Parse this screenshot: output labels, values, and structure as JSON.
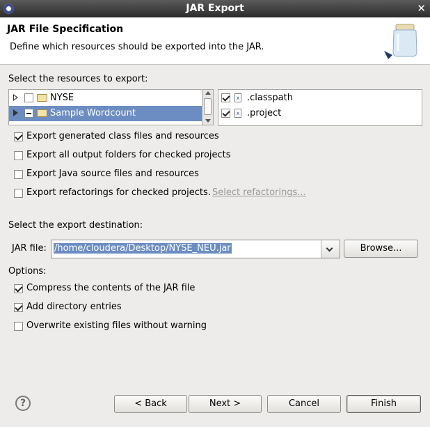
{
  "window": {
    "title": "JAR Export",
    "close": "✕"
  },
  "banner": {
    "title": "JAR File Specification",
    "description": "Define which resources should be exported into the JAR."
  },
  "resources": {
    "label": "Select the resources to export:",
    "tree": [
      {
        "label": "NYSE",
        "checked": false,
        "selected": false
      },
      {
        "label": "Sample Wordcount",
        "checked": "partial",
        "selected": true
      }
    ],
    "files": [
      {
        "label": ".classpath",
        "checked": true
      },
      {
        "label": ".project",
        "checked": true
      }
    ]
  },
  "options_top": [
    {
      "label": "Export generated class files and resources",
      "checked": true
    },
    {
      "label": "Export all output folders for checked projects",
      "checked": false
    },
    {
      "label": "Export Java source files and resources",
      "checked": false
    },
    {
      "label": "Export refactorings for checked projects.",
      "checked": false
    }
  ],
  "select_refactorings": "Select refactorings...",
  "destination": {
    "label": "Select the export destination:",
    "jar_label": "JAR file:",
    "jar_value": "/home/cloudera/Desktop/NYSE_NEU.jar",
    "browse": "Browse..."
  },
  "options": {
    "label": "Options:",
    "items": [
      {
        "label": "Compress the contents of the JAR file",
        "checked": true
      },
      {
        "label": "Add directory entries",
        "checked": true
      },
      {
        "label": "Overwrite existing files without warning",
        "checked": false
      }
    ]
  },
  "buttons": {
    "help": "?",
    "back": "< Back",
    "next": "Next >",
    "cancel": "Cancel",
    "finish": "Finish"
  }
}
